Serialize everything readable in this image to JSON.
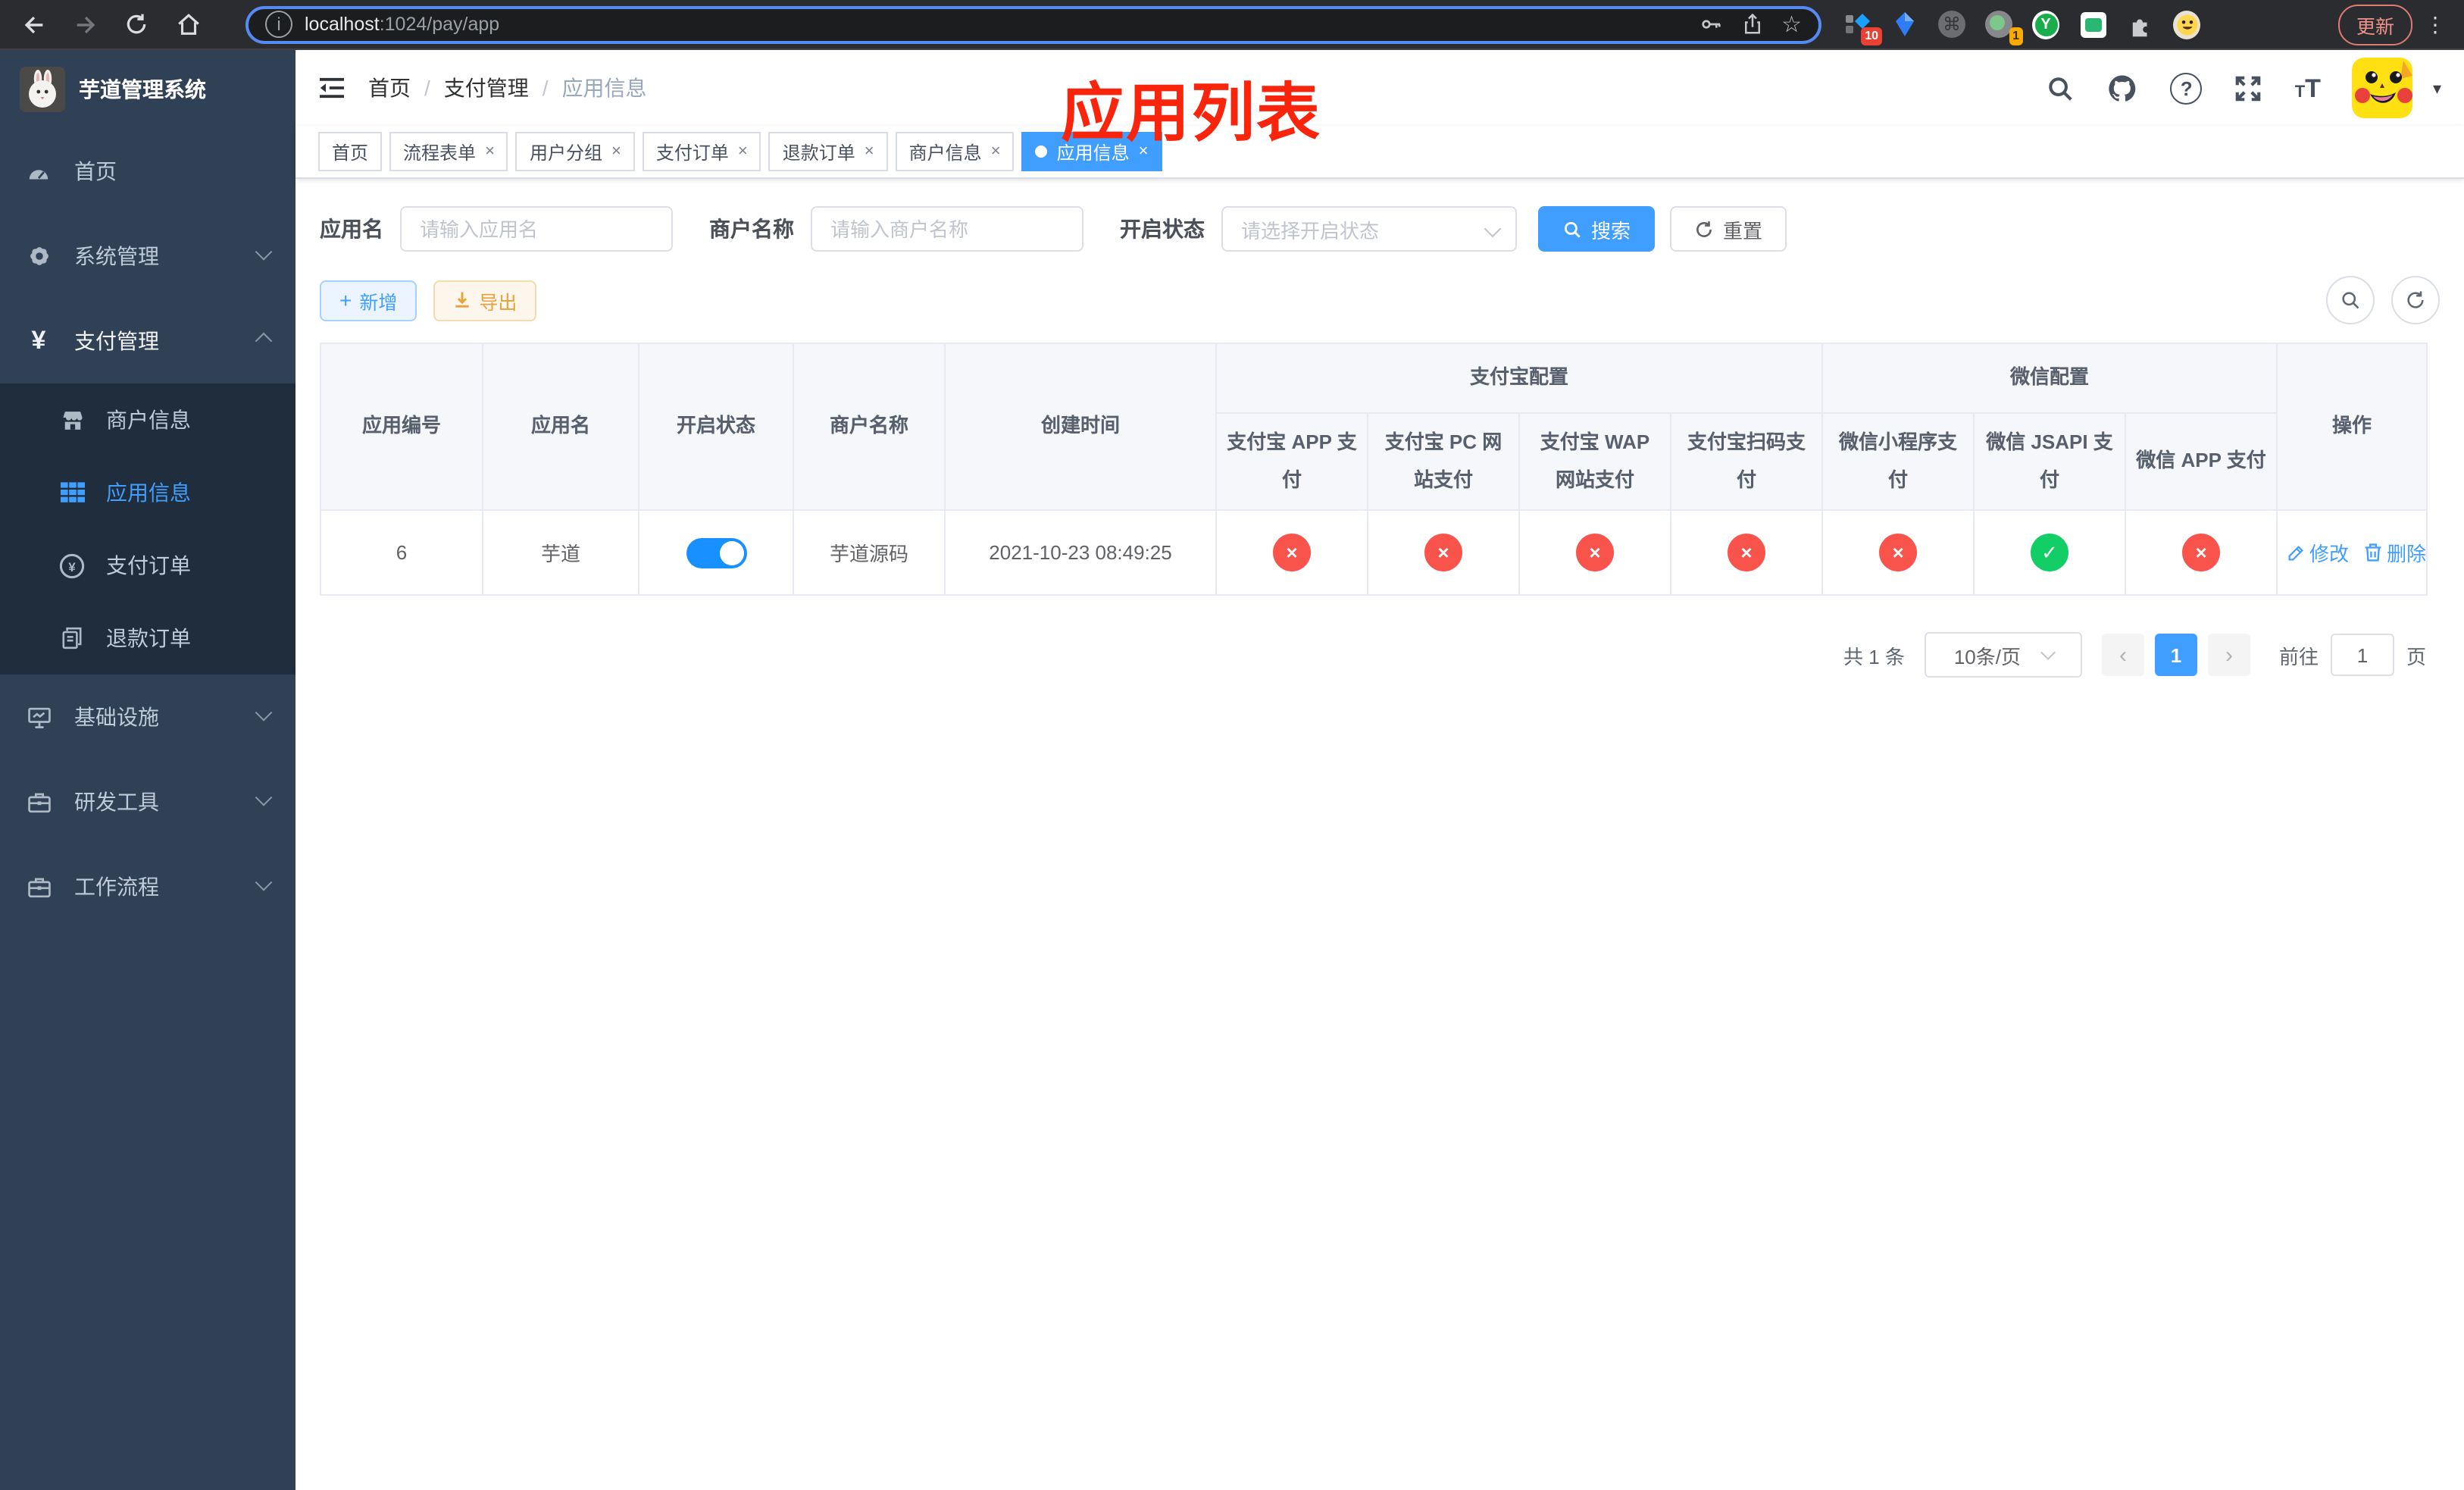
{
  "browser": {
    "url_host": "localhost",
    "url_rest": ":1024/pay/app",
    "update_label": "更新",
    "badge_red": "10",
    "badge_orange": "1"
  },
  "icons": {
    "info": "ⓘ",
    "star": "☆",
    "command": "⌘",
    "y_letter": "Y",
    "kebab": "⋮",
    "close": "×",
    "check": "✓",
    "cross": "×",
    "caret_down": "▾",
    "breadcrumb_sep": "/",
    "plus": "+",
    "question": "?",
    "text_small": "T",
    "text_large": "T",
    "prev": "‹",
    "next": "›",
    "yen": "¥"
  },
  "sidebar": {
    "title": "芋道管理系统",
    "home": "首页",
    "system": "系统管理",
    "payment": "支付管理",
    "sub_merchant": "商户信息",
    "sub_app": "应用信息",
    "sub_pay_order": "支付订单",
    "sub_refund_order": "退款订单",
    "infra": "基础设施",
    "devtools": "研发工具",
    "workflow": "工作流程"
  },
  "breadcrumb": {
    "home": "首页",
    "section": "支付管理",
    "current": "应用信息"
  },
  "annotation": {
    "title": "应用列表"
  },
  "tabs": [
    {
      "label": "首页",
      "closable": false
    },
    {
      "label": "流程表单",
      "closable": true
    },
    {
      "label": "用户分组",
      "closable": true
    },
    {
      "label": "支付订单",
      "closable": true
    },
    {
      "label": "退款订单",
      "closable": true
    },
    {
      "label": "商户信息",
      "closable": true
    },
    {
      "label": "应用信息",
      "closable": true,
      "active": true
    }
  ],
  "filters": {
    "app_name_label": "应用名",
    "app_name_placeholder": "请输入应用名",
    "merchant_label": "商户名称",
    "merchant_placeholder": "请输入商户名称",
    "status_label": "开启状态",
    "status_placeholder": "请选择开启状态",
    "search_label": "搜索",
    "reset_label": "重置"
  },
  "toolbar": {
    "add_label": "新增",
    "export_label": "导出"
  },
  "table": {
    "columns": {
      "id": "应用编号",
      "name": "应用名",
      "status": "开启状态",
      "merchant": "商户名称",
      "created": "创建时间",
      "alipay_group": "支付宝配置",
      "wechat_group": "微信配置",
      "actions": "操作"
    },
    "sub_columns": [
      "支付宝 APP 支付",
      "支付宝 PC 网站支付",
      "支付宝 WAP 网站支付",
      "支付宝扫码支付",
      "微信小程序支付",
      "微信 JSAPI 支付",
      "微信 APP 支付"
    ],
    "row": {
      "id": "6",
      "name": "芋道",
      "enabled": true,
      "merchant": "芋道源码",
      "created": "2021-10-23 08:49:25",
      "pay_statuses": [
        "no",
        "no",
        "no",
        "no",
        "no",
        "yes",
        "no"
      ],
      "edit_label": "修改",
      "delete_label": "删除"
    }
  },
  "pagination": {
    "total_label": "共 1 条",
    "page_size": "10条/页",
    "current_page": "1",
    "goto_label": "前往",
    "goto_value": "1",
    "unit_label": "页"
  },
  "colors": {
    "accent": "#409eff",
    "toggle_on": "#1890ff",
    "danger": "#f9544b",
    "success": "#13ce66",
    "annotation": "#f8240b",
    "sidebar_bg": "#304156",
    "submenu_bg": "#1f2d3d"
  }
}
